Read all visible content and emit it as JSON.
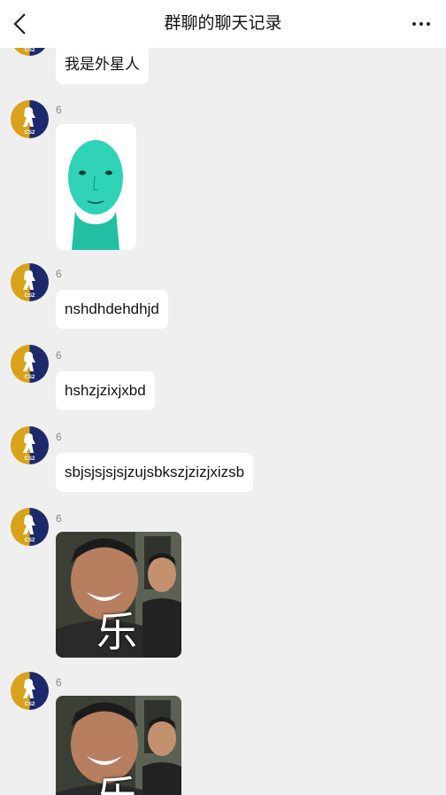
{
  "header": {
    "title": "群聊的聊天记录",
    "back_icon": "chevron-left-icon",
    "more_icon": "more-dots-icon"
  },
  "colors": {
    "background": "#efefef",
    "bubble": "#ffffff",
    "avatar_gold": "#d9a21b",
    "avatar_navy": "#1c2a6b"
  },
  "messages": [
    {
      "type": "text",
      "sender": "",
      "text": "我是外星人"
    },
    {
      "type": "image",
      "sender": "6",
      "image": "teal-alien-face-sticker"
    },
    {
      "type": "text",
      "sender": "6",
      "text": "nshdhdehdhjd"
    },
    {
      "type": "text",
      "sender": "6",
      "text": "hshzjzixjxbd"
    },
    {
      "type": "text",
      "sender": "6",
      "text": "sbjsjsjsjsjzujsbkszjzizjxizsb"
    },
    {
      "type": "image",
      "sender": "6",
      "image": "laughing-man-sticker",
      "overlay_text": "乐"
    },
    {
      "type": "image",
      "sender": "6",
      "image": "laughing-man-sticker",
      "overlay_text": "乐"
    }
  ]
}
